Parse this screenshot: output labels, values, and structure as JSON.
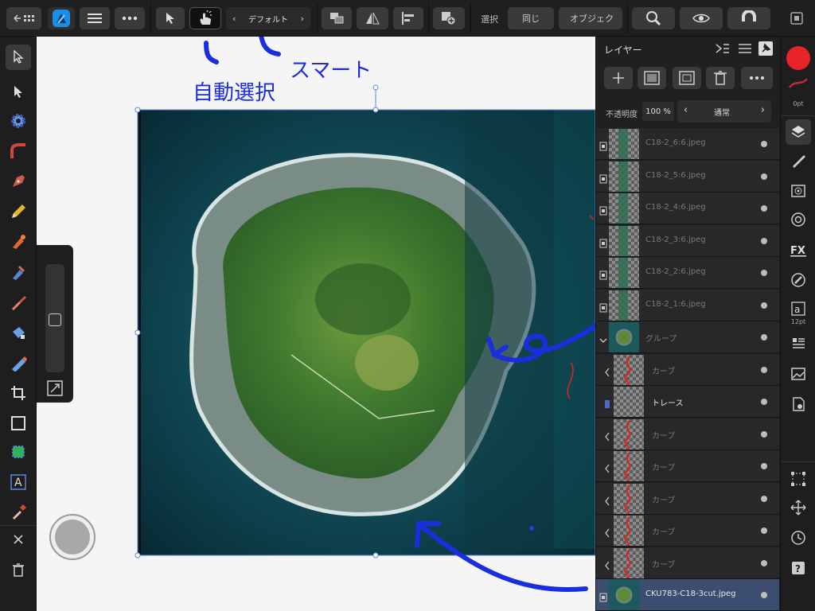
{
  "toolbar": {
    "back_icon": "back-arrow-grid-icon",
    "app_icon": "affinity-designer-icon",
    "snap_default_label": "デフォルト",
    "select_label": "選択",
    "same_label": "同じ",
    "object_label": "オブジェク"
  },
  "annotations": {
    "auto_select": "自動選択",
    "smart": "スマート"
  },
  "layers_panel": {
    "title": "レイヤー",
    "opacity_label": "不透明度",
    "opacity_value": "100 %",
    "blend_mode": "通常",
    "layers": [
      {
        "name": "C18-2_6:6.jpeg",
        "kind": "image"
      },
      {
        "name": "C18-2_5:6.jpeg",
        "kind": "image"
      },
      {
        "name": "C18-2_4:6.jpeg",
        "kind": "image"
      },
      {
        "name": "C18-2_3:6.jpeg",
        "kind": "image"
      },
      {
        "name": "C18-2_2:6.jpeg",
        "kind": "image"
      },
      {
        "name": "C18-2_1:6.jpeg",
        "kind": "image"
      },
      {
        "name": "グループ",
        "kind": "group"
      },
      {
        "name": "カーブ",
        "kind": "curve"
      },
      {
        "name": "トレース",
        "kind": "layer"
      },
      {
        "name": "カーブ",
        "kind": "curve"
      },
      {
        "name": "カーブ",
        "kind": "curve"
      },
      {
        "name": "カーブ",
        "kind": "curve"
      },
      {
        "name": "カーブ",
        "kind": "curve"
      },
      {
        "name": "カーブ",
        "kind": "curve"
      },
      {
        "name": "CKU783-C18-3cut.jpeg",
        "kind": "image-selected"
      }
    ]
  },
  "studio": {
    "color": "#e8232a",
    "stroke_width": "0pt",
    "text_size": "12pt"
  }
}
